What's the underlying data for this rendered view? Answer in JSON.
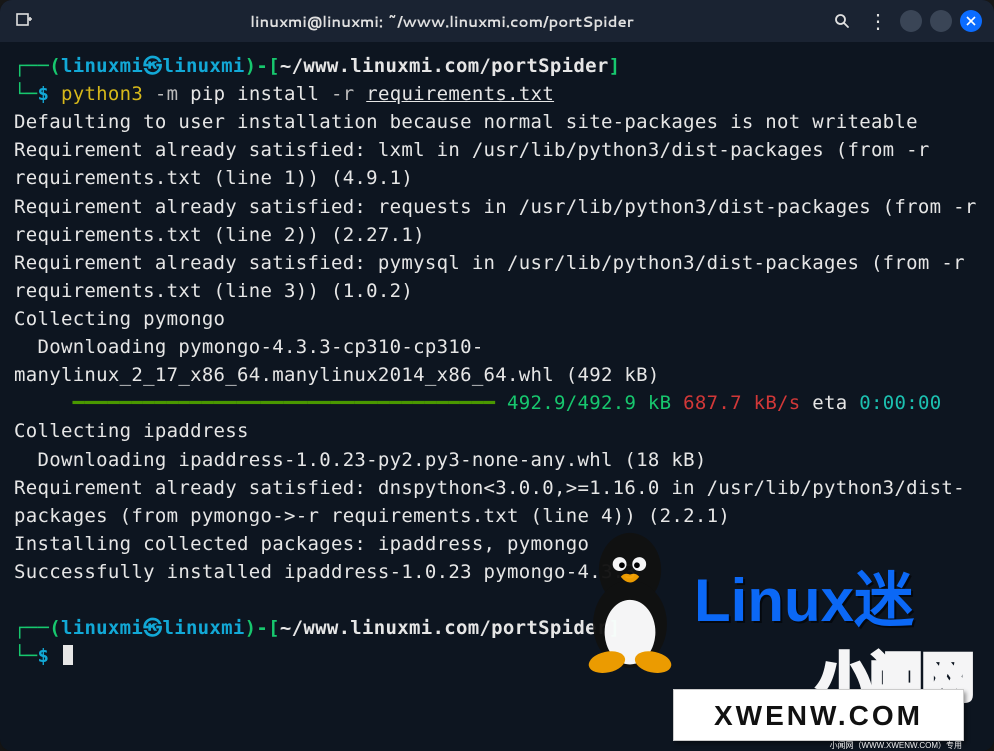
{
  "window": {
    "title": "linuxmi@linuxmi: ~/www.linuxmi.com/portSpider"
  },
  "prompt1": {
    "open": "┌──(",
    "user": "linuxmi",
    "sym": "㉿",
    "host": "linuxmi",
    "close_user": ")-[",
    "cwd": "~/www.linuxmi.com/portSpider",
    "close_cwd": "]",
    "line2_open": "└─",
    "dollar": "$ ",
    "cmd_bin": "python3",
    "cmd_flag": " -m ",
    "cmd_pip": "pip install",
    "cmd_flag2": " -r ",
    "cmd_file": "requirements.txt"
  },
  "out": {
    "l1": "Defaulting to user installation because normal site-packages is not writeable",
    "l2": "Requirement already satisfied: lxml in /usr/lib/python3/dist-packages (from -r requirements.txt (line 1)) (4.9.1)",
    "l3": "Requirement already satisfied: requests in /usr/lib/python3/dist-packages (from -r requirements.txt (line 2)) (2.27.1)",
    "l4": "Requirement already satisfied: pymysql in /usr/lib/python3/dist-packages (from -r requirements.txt (line 3)) (1.0.2)",
    "l5": "Collecting pymongo",
    "l6": "  Downloading pymongo-4.3.3-cp310-cp310-manylinux_2_17_x86_64.manylinux2014_x86_64.whl (492 kB)",
    "progress_bar": "     ━━━━━━━━━━━━━━━━━━━━━━━━━━━━━━━━━━━━",
    "progress_size": " 492.9/492.9 kB",
    "progress_speed": " 687.7 kB/s",
    "progress_eta": " eta",
    "progress_time": " 0:00:00",
    "l7": "Collecting ipaddress",
    "l8": "  Downloading ipaddress-1.0.23-py2.py3-none-any.whl (18 kB)",
    "l9": "Requirement already satisfied: dnspython<3.0.0,>=1.16.0 in /usr/lib/python3/dist-packages (from pymongo->-r requirements.txt (line 4)) (2.2.1)",
    "l10": "Installing collected packages: ipaddress, pymongo",
    "l11": "Successfully installed ipaddress-1.0.23 pymongo-4.3.3"
  },
  "prompt2": {
    "open": "┌──(",
    "user": "linuxmi",
    "sym": "㉿",
    "host": "linuxmi",
    "close_user": ")-[",
    "cwd": "~/www.linuxmi.com/portSpider",
    "close_cwd": "]",
    "line2_open": "└─",
    "dollar": "$ "
  },
  "watermark": {
    "brand": "Linux迷",
    "overlay": "小闻网",
    "card": "XWENW.COM",
    "sub": "小闻网（WWW.XWENW.COM）专用"
  }
}
